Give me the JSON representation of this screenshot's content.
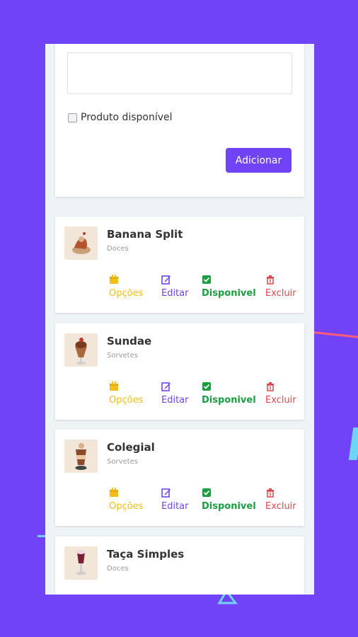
{
  "form": {
    "description_value": "",
    "available_label": "Produto disponível",
    "add_button": "Adicionar"
  },
  "actions": {
    "options": "Opções",
    "edit": "Editar",
    "available": "Disponivel",
    "delete": "Excluir"
  },
  "products": [
    {
      "name": "Banana Split",
      "category": "Doces"
    },
    {
      "name": "Sundae",
      "category": "Sorvetes"
    },
    {
      "name": "Colegial",
      "category": "Sorvetes"
    },
    {
      "name": "Taça Simples",
      "category": "Doces"
    }
  ],
  "colors": {
    "background": "#7043f7",
    "accent": "#7043f7",
    "options": "#f6bd16",
    "available": "#1a9e3f",
    "delete": "#e0464e"
  },
  "icons": {
    "options": "box-icon",
    "edit": "edit-icon",
    "available": "check-square-icon",
    "delete": "trash-icon"
  }
}
